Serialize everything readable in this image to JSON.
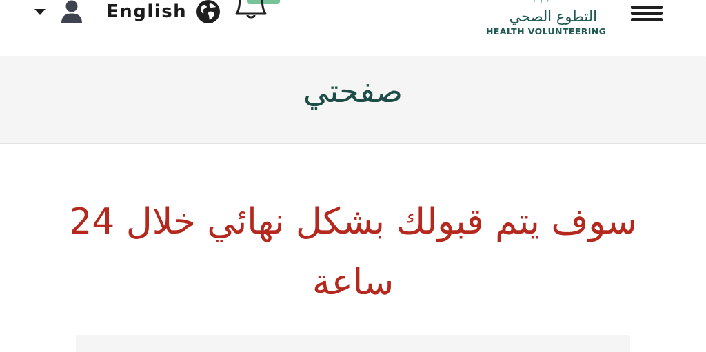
{
  "header": {
    "language_label": "English",
    "user_dropdown_icon": "chevron-down-icon",
    "user_icon": "user-icon",
    "globe_icon": "globe-icon",
    "bell_icon": "bell-icon",
    "menu_icon": "hamburger-menu-icon",
    "logo": {
      "arabic_text": "التطوع الصحي",
      "english_text": "HEALTH VOLUNTEERING"
    }
  },
  "page": {
    "title": "صفحتي"
  },
  "main": {
    "message": "سوف يتم قبولك بشكل نهائي خلال 24 ساعة"
  },
  "colors": {
    "brand_teal": "#1e5a52",
    "title_color": "#1e4d48",
    "message_red": "#b5281e",
    "badge_green": "#78c29a",
    "band_bg": "#f5f5f5"
  }
}
